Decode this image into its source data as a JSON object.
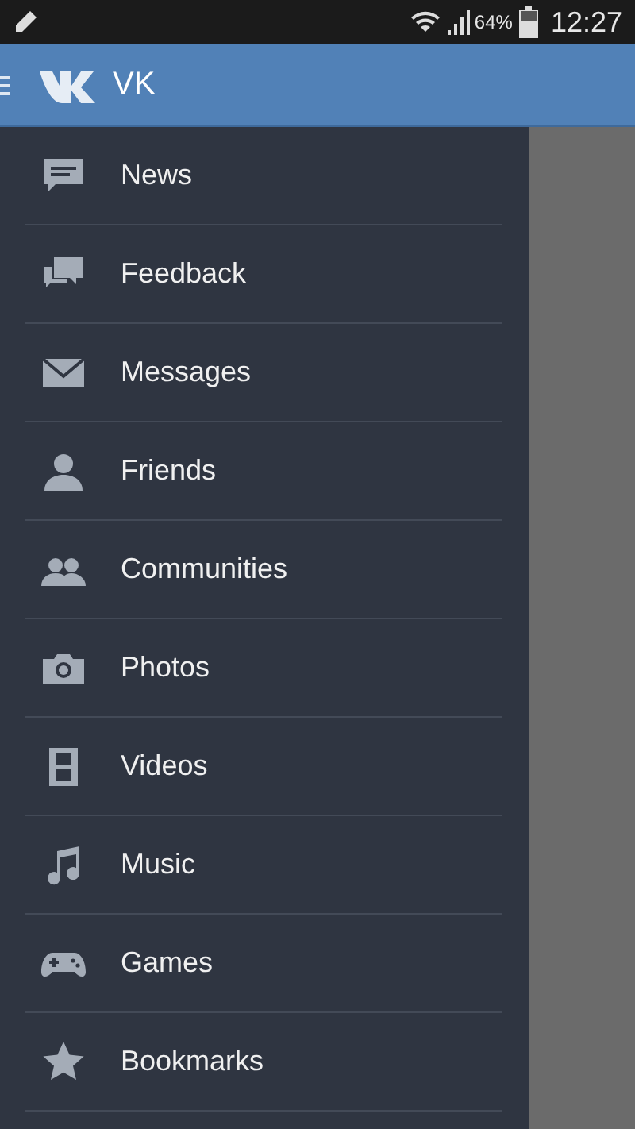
{
  "status_bar": {
    "battery_percent": "64%",
    "time": "12:27"
  },
  "header": {
    "title": "VK"
  },
  "menu": [
    {
      "kind": "news",
      "label": "News"
    },
    {
      "kind": "feedback",
      "label": "Feedback"
    },
    {
      "kind": "messages",
      "label": "Messages"
    },
    {
      "kind": "friends",
      "label": "Friends"
    },
    {
      "kind": "communities",
      "label": "Communities"
    },
    {
      "kind": "photos",
      "label": "Photos"
    },
    {
      "kind": "videos",
      "label": "Videos"
    },
    {
      "kind": "music",
      "label": "Music"
    },
    {
      "kind": "games",
      "label": "Games"
    },
    {
      "kind": "bookmarks",
      "label": "Bookmarks"
    }
  ]
}
